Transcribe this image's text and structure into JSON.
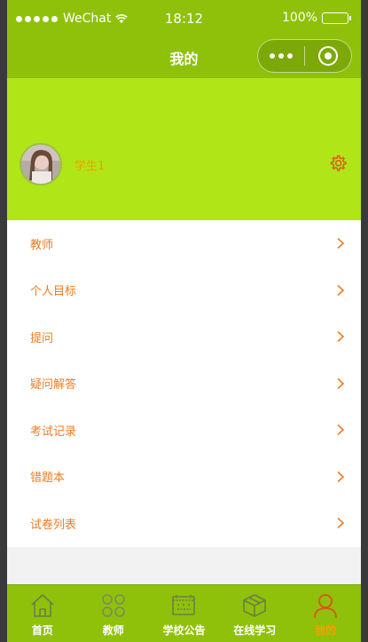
{
  "status_bar": {
    "carrier": "WeChat",
    "time": "18:12",
    "battery": "100%"
  },
  "nav": {
    "title": "我的"
  },
  "profile": {
    "username": "学生1"
  },
  "menu": {
    "items": [
      {
        "label": "教师"
      },
      {
        "label": "个人目标"
      },
      {
        "label": "提问"
      },
      {
        "label": "疑问解答"
      },
      {
        "label": "考试记录"
      },
      {
        "label": "错题本"
      },
      {
        "label": "试卷列表"
      }
    ]
  },
  "tabbar": {
    "tabs": [
      {
        "label": "首页",
        "icon": "home-icon"
      },
      {
        "label": "教师",
        "icon": "grid-icon"
      },
      {
        "label": "学校公告",
        "icon": "notice-icon"
      },
      {
        "label": "在线学习",
        "icon": "box-icon"
      },
      {
        "label": "我的",
        "icon": "user-icon",
        "active": true
      }
    ]
  },
  "colors": {
    "accent": "#8fc10a",
    "header_bg": "#b0e618",
    "menu_text": "#f07b22",
    "active_tab": "#f5a000"
  }
}
